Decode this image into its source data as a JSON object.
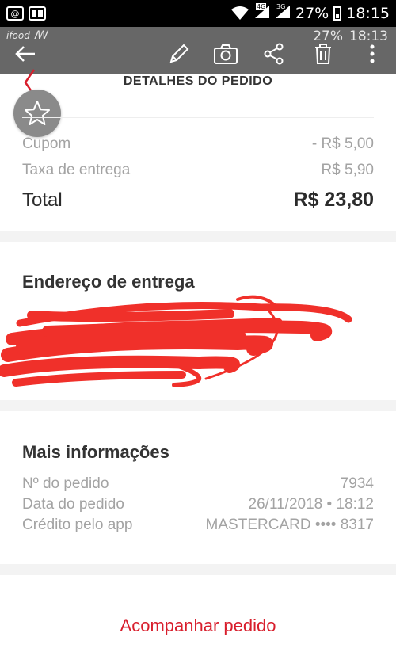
{
  "status_bar": {
    "left_icons": [
      "@",
      "app-notification"
    ],
    "network_4g": "4G",
    "network_3g": "3G",
    "battery": "27%",
    "time": "18:15"
  },
  "editor_overlay": {
    "status_time": "18:13",
    "status_battery": "27%",
    "left_label": "ifood",
    "icons": [
      "back-arrow-icon",
      "pencil-icon",
      "camera-icon",
      "share-icon",
      "trash-icon",
      "more-vert-icon"
    ]
  },
  "header": {
    "title": "DETALHES DO PEDIDO"
  },
  "summary": {
    "coupon_label": "Cupom",
    "coupon_value": "- R$ 5,00",
    "delivery_label": "Taxa de entrega",
    "delivery_value": "R$ 5,90",
    "total_label": "Total",
    "total_value": "R$ 23,80"
  },
  "address": {
    "title": "Endereço de entrega"
  },
  "info": {
    "title": "Mais informações",
    "rows": [
      {
        "label": "Nº do pedido",
        "value": "7934"
      },
      {
        "label": "Data do pedido",
        "value": "26/11/2018 • 18:12"
      },
      {
        "label": "Crédito pelo app",
        "value": "MASTERCARD •••• 8317"
      }
    ]
  },
  "footer": {
    "track_label": "Acompanhar pedido"
  },
  "colors": {
    "accent": "#d81e2c",
    "scribble": "#f0302a"
  }
}
